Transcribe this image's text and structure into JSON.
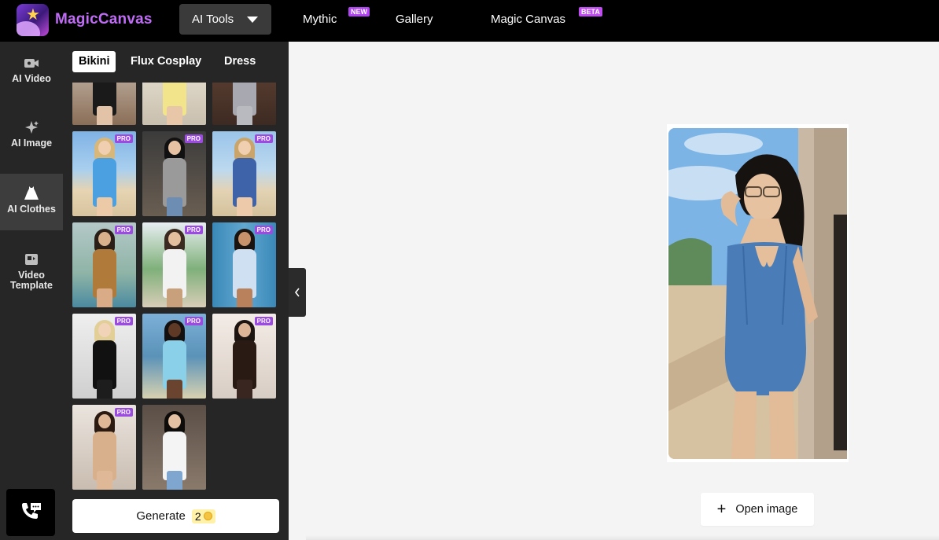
{
  "app": {
    "brand": "MagicCanvas",
    "accent_color": "#c06cf7"
  },
  "topnav": {
    "tools_dropdown": "AI Tools",
    "links": [
      {
        "label": "Mythic",
        "badge": "NEW"
      },
      {
        "label": "Gallery",
        "badge": ""
      },
      {
        "label": "Magic Canvas",
        "badge": "BETA"
      }
    ]
  },
  "rail": {
    "items": [
      {
        "label": "AI Video",
        "icon": "video-camera-icon"
      },
      {
        "label": "AI Image",
        "icon": "sparkle-icon"
      },
      {
        "label": "AI Clothes",
        "icon": "dress-icon",
        "active": true
      },
      {
        "label": "Video Template",
        "icon": "video-template-icon"
      }
    ],
    "support_icon": "phone-chat-icon"
  },
  "panel": {
    "tabs": [
      "Bikini",
      "Flux Cosplay",
      "Dress"
    ],
    "active_tab": "Bikini",
    "pro_badge": "PRO",
    "generate_label": "Generate",
    "credits": "2"
  },
  "main": {
    "open_image_label": "Open image"
  }
}
